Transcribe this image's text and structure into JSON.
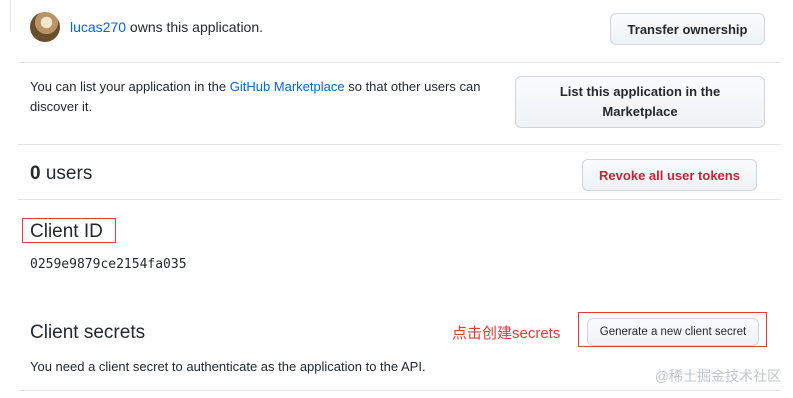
{
  "owner": {
    "username": "lucas270",
    "text": " owns this application.",
    "transfer_label": "Transfer ownership"
  },
  "marketplace": {
    "text_before": "You can list your application in the ",
    "link": "GitHub Marketplace",
    "text_after": " so that other users can discover it.",
    "button_label": "List this application in the Marketplace"
  },
  "users": {
    "count": "0",
    "label": " users",
    "revoke_label": "Revoke all user tokens"
  },
  "client_id": {
    "title": "Client ID",
    "value": "0259e9879ce2154fa035"
  },
  "client_secrets": {
    "title": "Client secrets",
    "annotation": "点击创建secrets",
    "generate_label": "Generate a new client secret",
    "description": "You need a client secret to authenticate as the application to the API."
  },
  "watermark": "@稀土掘金技术社区",
  "colors": {
    "link": "#0366d6",
    "danger": "#cb2431",
    "annotation": "#e53935"
  }
}
